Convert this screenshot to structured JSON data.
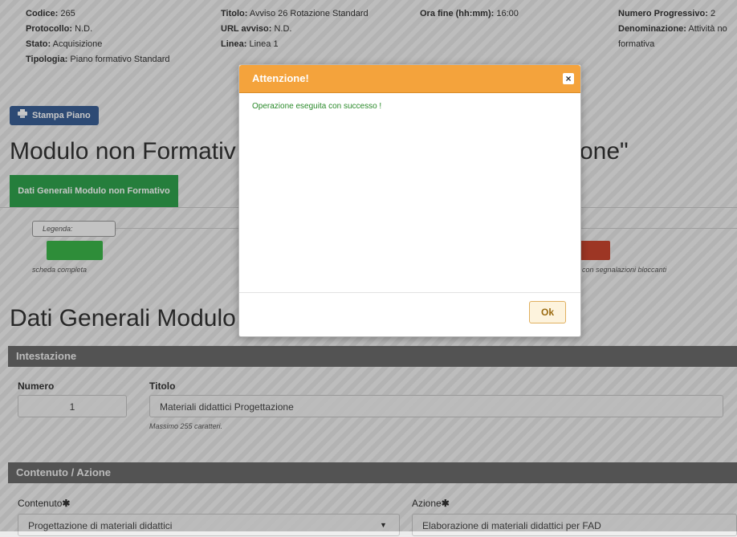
{
  "info": {
    "codice_label": "Codice:",
    "codice": "265",
    "protocollo_label": "Protocollo:",
    "protocollo": "N.D.",
    "stato_label": "Stato:",
    "stato": "Acquisizione",
    "tipologia_label": "Tipologia:",
    "tipologia": "Piano formativo Standard",
    "titolo_label": "Titolo:",
    "titolo": "Avviso 26 Rotazione Standard",
    "url_label": "URL avviso:",
    "url": "N.D.",
    "linea_label": "Linea:",
    "linea": "Linea 1",
    "orafine_label": "Ora fine (hh:mm):",
    "orafine": "16:00",
    "numprog_label": "Numero Progressivo:",
    "numprog": "2",
    "denom_label": "Denominazione:",
    "denom": "Attività no",
    "denom_cont": "formativa"
  },
  "toolbar": {
    "print_label": "Stampa Piano"
  },
  "page_title_left": "Modulo non Formativ",
  "page_title_right": "one\"",
  "tab_label": "Dati Generali Modulo non Formativo",
  "legend": {
    "label": "Legenda:",
    "complete": "scheda completa",
    "blocking": "con segnalazioni bloccanti",
    "green": "#3bb54a",
    "red": "#c9462f"
  },
  "section_title": "Dati Generali Modulo",
  "intestazione": {
    "header": "Intestazione",
    "numero_label": "Numero",
    "numero_value": "1",
    "titolo_label": "Titolo",
    "titolo_value": "Materiali didattici Progettazione",
    "titolo_hint": "Massimo 255 caratteri."
  },
  "contenuto": {
    "header": "Contenuto / Azione",
    "contenuto_label": "Contenuto",
    "contenuto_value": "Progettazione di materiali didattici",
    "azione_label": "Azione",
    "azione_value": "Elaborazione di materiali didattici per FAD"
  },
  "dialog": {
    "title": "Attenzione!",
    "message": "Operazione eseguita con successo !",
    "ok": "Ok"
  }
}
